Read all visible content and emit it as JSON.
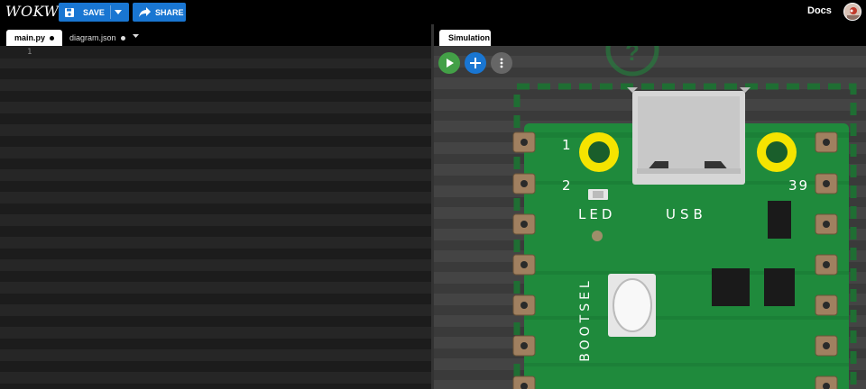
{
  "app": {
    "logo": "WOKWI"
  },
  "toolbar": {
    "save_label": "SAVE",
    "share_label": "SHARE",
    "docs_label": "Docs"
  },
  "editor": {
    "tabs": [
      {
        "label": "main.py",
        "active": true
      },
      {
        "label": "diagram.json",
        "active": false
      }
    ],
    "line_numbers": [
      "1"
    ]
  },
  "simulation": {
    "tab_label": "Simulation",
    "board": {
      "pin_label_1": "1",
      "pin_label_2": "2",
      "pin_label_39": "39",
      "led_label": "LED",
      "usb_label": "USB",
      "bootsel_label": "BOOTSEL"
    }
  },
  "colors": {
    "brand_blue": "#1976d2",
    "play_green": "#43a047",
    "board_green": "#1f8a3c",
    "pad_yellow": "#f5e400"
  },
  "icons": {
    "save": "floppy-disk-icon",
    "share": "share-arrow-icon",
    "play": "play-icon",
    "add": "plus-icon",
    "more": "more-vertical-icon"
  }
}
